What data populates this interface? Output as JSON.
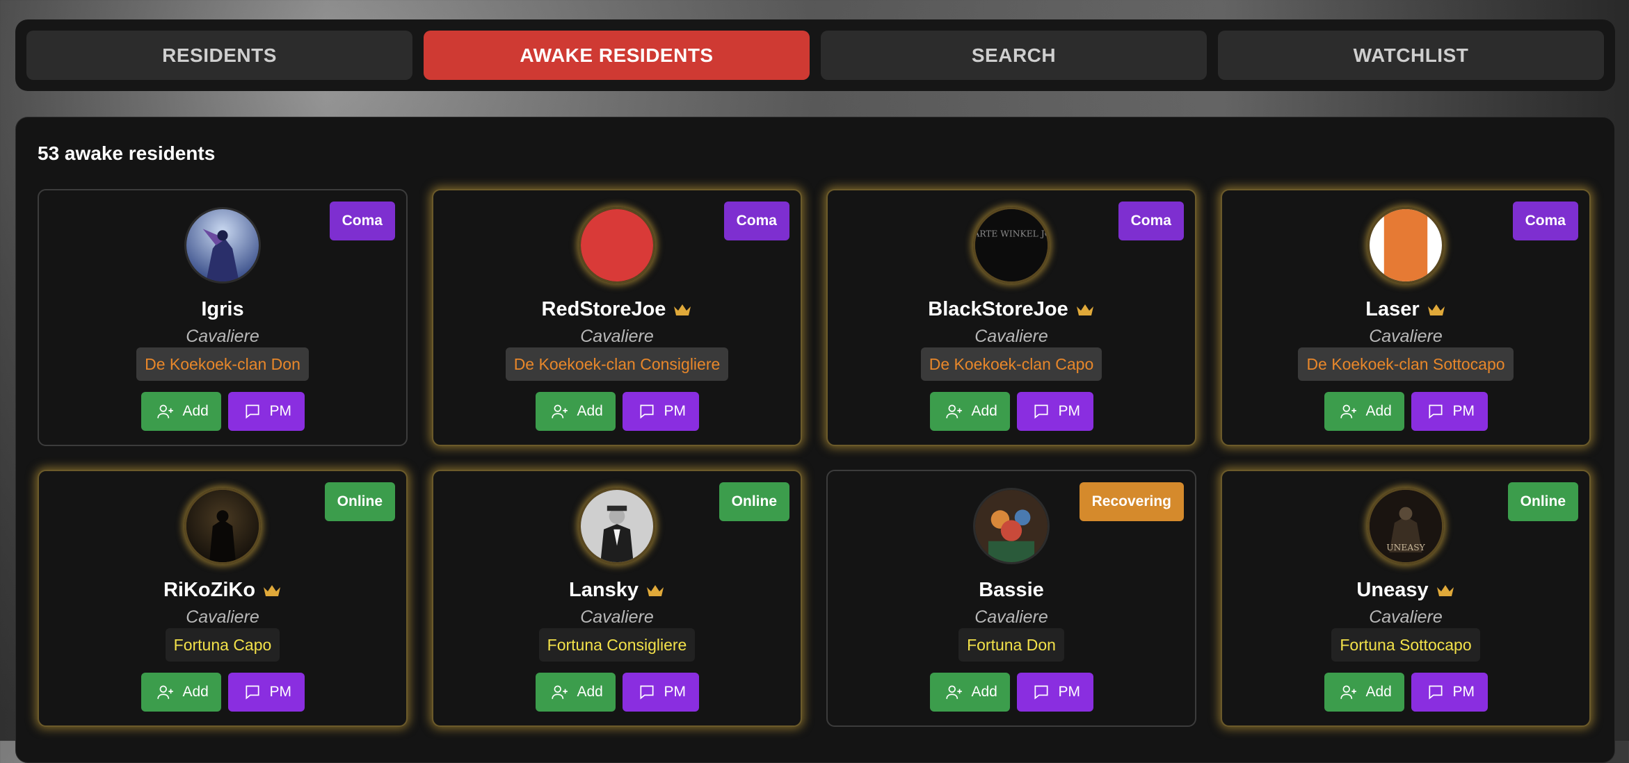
{
  "tabs": [
    {
      "label": "RESIDENTS",
      "active": false
    },
    {
      "label": "AWAKE RESIDENTS",
      "active": true
    },
    {
      "label": "SEARCH",
      "active": false
    },
    {
      "label": "WATCHLIST",
      "active": false
    }
  ],
  "count_text": "53 awake residents",
  "buttons": {
    "add": "Add",
    "pm": "PM"
  },
  "colors": {
    "accent_red": "#cf3a33",
    "coma": "#7e2fd0",
    "online": "#3c9d4c",
    "recovering": "#d58a2c",
    "clan_text": "#e8872a",
    "fortuna_text": "#f3e24a"
  },
  "residents": [
    {
      "name": "Igris",
      "rank": "Cavaliere",
      "tag": "De Koekoek-clan Don",
      "status": "Coma",
      "crown": false
    },
    {
      "name": "RedStoreJoe",
      "rank": "Cavaliere",
      "tag": "De Koekoek-clan Consigliere",
      "status": "Coma",
      "crown": true
    },
    {
      "name": "BlackStoreJoe",
      "rank": "Cavaliere",
      "tag": "De Koekoek-clan Capo",
      "status": "Coma",
      "crown": true
    },
    {
      "name": "Laser",
      "rank": "Cavaliere",
      "tag": "De Koekoek-clan Sottocapo",
      "status": "Coma",
      "crown": true
    },
    {
      "name": "RiKoZiKo",
      "rank": "Cavaliere",
      "tag": "Fortuna Capo",
      "status": "Online",
      "crown": true
    },
    {
      "name": "Lansky",
      "rank": "Cavaliere",
      "tag": "Fortuna Consigliere",
      "status": "Online",
      "crown": true
    },
    {
      "name": "Bassie",
      "rank": "Cavaliere",
      "tag": "Fortuna Don",
      "status": "Recovering",
      "crown": false
    },
    {
      "name": "Uneasy",
      "rank": "Cavaliere",
      "tag": "Fortuna Sottocapo",
      "status": "Online",
      "crown": true
    }
  ],
  "avatar_texts": {
    "black_store": "ZWARTE WINKEL JOZE",
    "uneasy": "UNEASY"
  }
}
